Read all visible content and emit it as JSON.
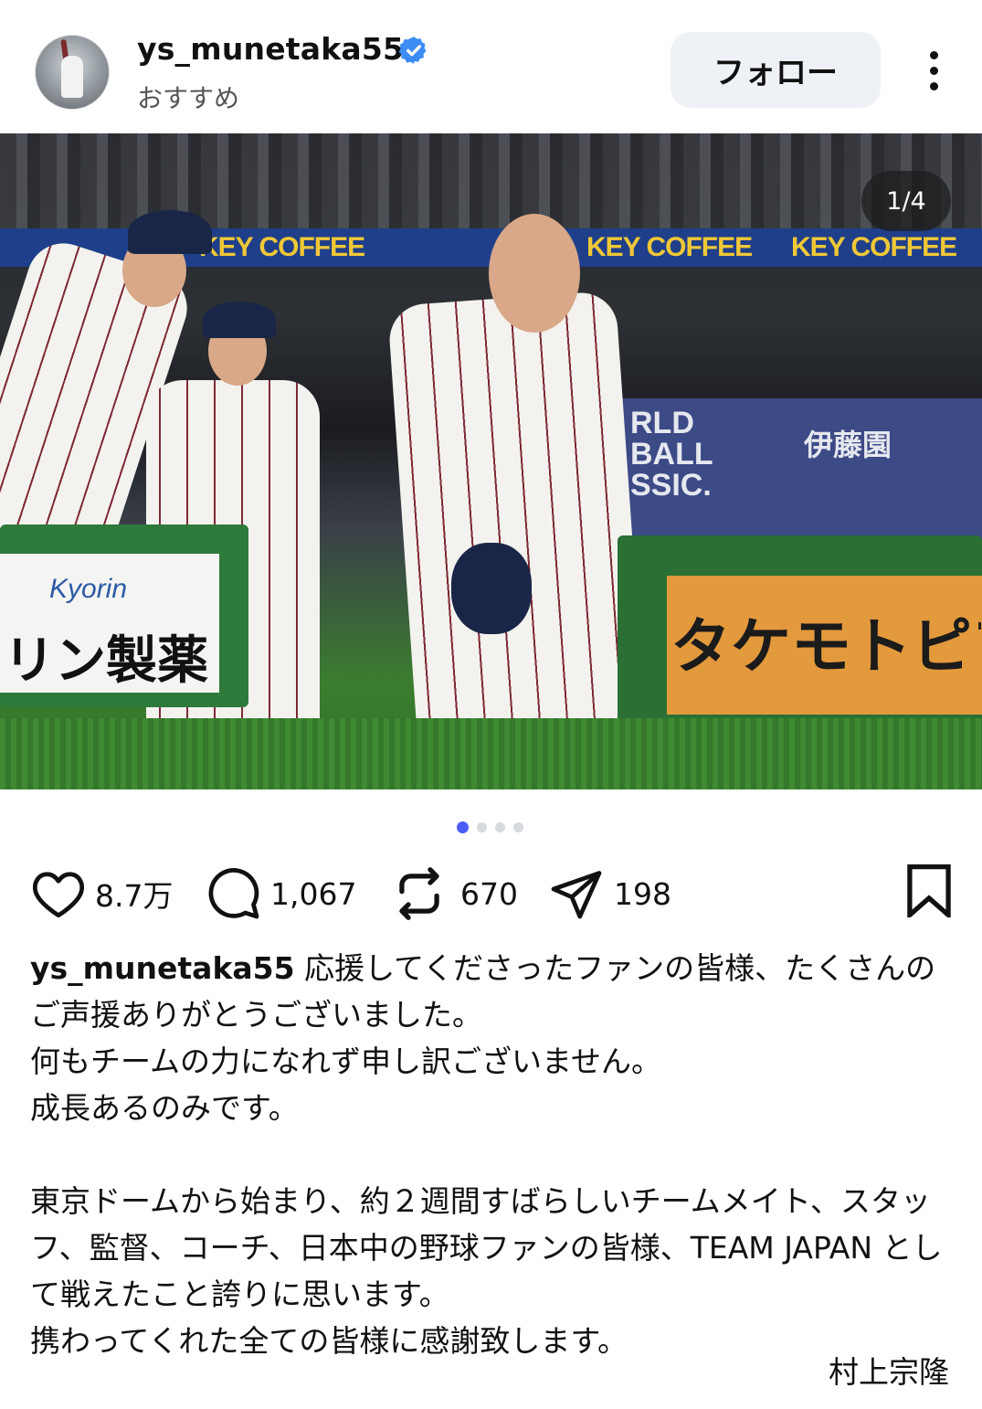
{
  "header": {
    "username": "ys_munetaka55",
    "subtext": "おすすめ",
    "follow_label": "フォロー"
  },
  "media": {
    "counter": "1/4",
    "banner_text": "KEY COFFEE",
    "ad_left_brand": "Kyorin",
    "ad_left_text": "リン製薬",
    "ad_right_text": "タケモトピア",
    "wall_text": "RLD\nBALL\nSSIC.",
    "wall_sponsor": "伊藤園",
    "page_total": 4,
    "page_current": 1
  },
  "actions": {
    "likes": "8.7万",
    "comments": "1,067",
    "reposts": "670",
    "shares": "198"
  },
  "caption": {
    "username": "ys_munetaka55",
    "text": " 応援してくださったファンの皆様、たくさんのご声援ありがとうございました。\n何もチームの力になれず申し訳ございません。\n成長あるのみです。\n\n東京ドームから始まり、約２週間すばらしいチームメイト、スタッフ、監督、コーチ、日本中の野球ファンの皆様、TEAM JAPAN として戦えたこと誇りに思います。\n携わってくれた全ての皆様に感謝致します。",
    "signature": "村上宗隆"
  },
  "colors": {
    "verified": "#3b8cf5",
    "active_dot": "#4a5cf5",
    "follow_bg": "#eef1f5"
  },
  "icons": [
    "verified-badge-icon",
    "more-options-icon",
    "heart-icon",
    "comment-icon",
    "repost-icon",
    "share-icon",
    "bookmark-icon"
  ]
}
